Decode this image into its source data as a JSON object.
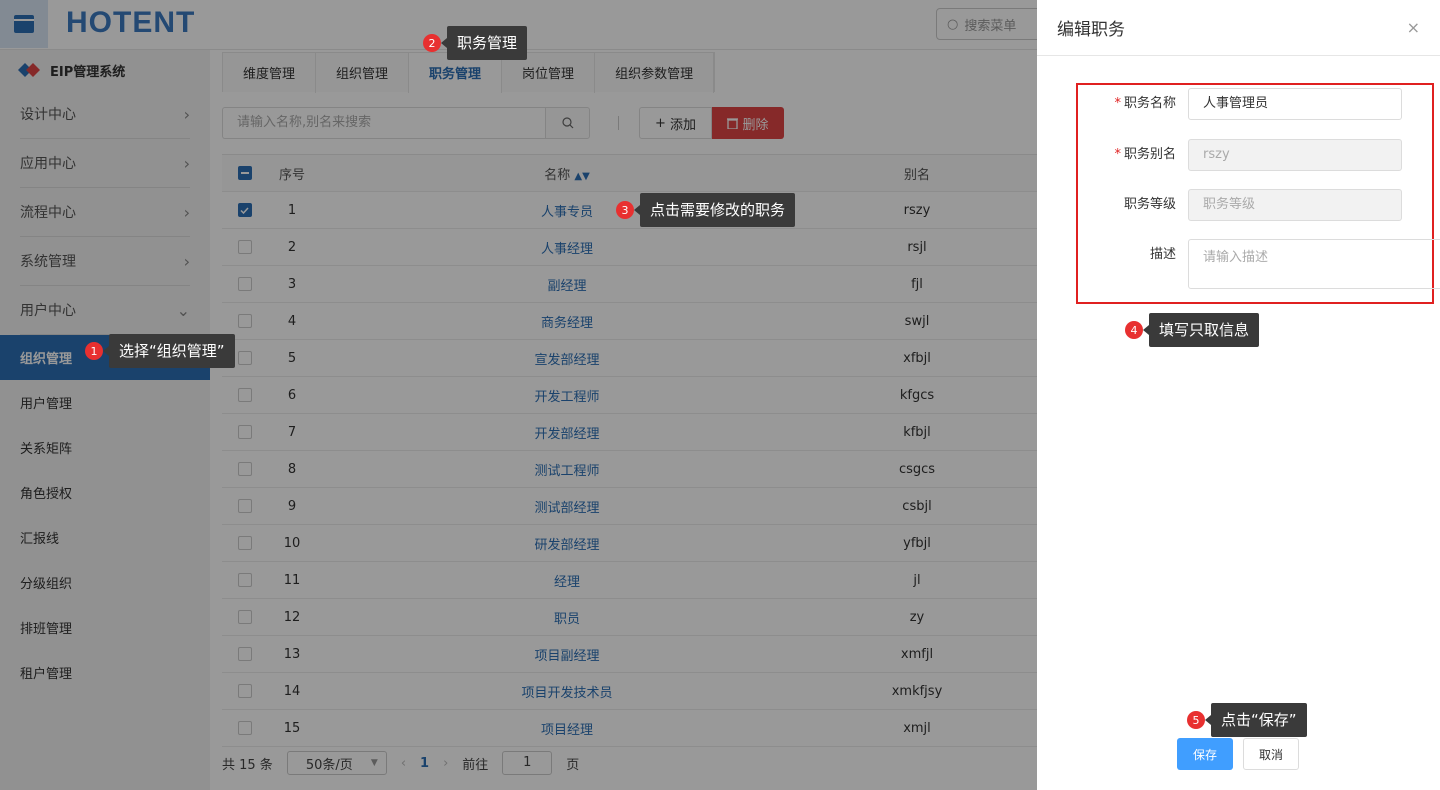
{
  "header": {
    "logo": "HOTENT",
    "search_placeholder": "搜索菜单"
  },
  "sidebar": {
    "brand": "EIP管理系统",
    "groups": [
      {
        "label": "设计中心",
        "chevron": "right"
      },
      {
        "label": "应用中心",
        "chevron": "right"
      },
      {
        "label": "流程中心",
        "chevron": "right"
      },
      {
        "label": "系统管理",
        "chevron": "right"
      },
      {
        "label": "用户中心",
        "chevron": "down"
      }
    ],
    "active_item": "组织管理",
    "items": [
      "用户管理",
      "关系矩阵",
      "角色授权",
      "汇报线",
      "分级组织",
      "排班管理",
      "租户管理"
    ]
  },
  "tabs": [
    "维度管理",
    "组织管理",
    "职务管理",
    "岗位管理",
    "组织参数管理"
  ],
  "active_tab": "职务管理",
  "toolbar": {
    "search_placeholder": "请输入名称,别名来搜索",
    "add_label": "添加",
    "delete_label": "删除"
  },
  "table": {
    "headers": {
      "index": "序号",
      "name": "名称",
      "alias": "别名"
    },
    "rows": [
      {
        "index": "1",
        "name": "人事专员",
        "alias": "rszy",
        "checked": true
      },
      {
        "index": "2",
        "name": "人事经理",
        "alias": "rsjl",
        "checked": false
      },
      {
        "index": "3",
        "name": "副经理",
        "alias": "fjl",
        "checked": false
      },
      {
        "index": "4",
        "name": "商务经理",
        "alias": "swjl",
        "checked": false
      },
      {
        "index": "5",
        "name": "宣发部经理",
        "alias": "xfbjl",
        "checked": false
      },
      {
        "index": "6",
        "name": "开发工程师",
        "alias": "kfgcs",
        "checked": false
      },
      {
        "index": "7",
        "name": "开发部经理",
        "alias": "kfbjl",
        "checked": false
      },
      {
        "index": "8",
        "name": "测试工程师",
        "alias": "csgcs",
        "checked": false
      },
      {
        "index": "9",
        "name": "测试部经理",
        "alias": "csbjl",
        "checked": false
      },
      {
        "index": "10",
        "name": "研发部经理",
        "alias": "yfbjl",
        "checked": false
      },
      {
        "index": "11",
        "name": "经理",
        "alias": "jl",
        "checked": false
      },
      {
        "index": "12",
        "name": "职员",
        "alias": "zy",
        "checked": false
      },
      {
        "index": "13",
        "name": "项目副经理",
        "alias": "xmfjl",
        "checked": false
      },
      {
        "index": "14",
        "name": "项目开发技术员",
        "alias": "xmkfjsy",
        "checked": false
      },
      {
        "index": "15",
        "name": "项目经理",
        "alias": "xmjl",
        "checked": false
      }
    ]
  },
  "pager": {
    "total": "共 15 条",
    "page_size": "50条/页",
    "current": "1",
    "goto_label": "前往",
    "goto_value": "1",
    "page_suffix": "页"
  },
  "drawer": {
    "title": "编辑职务",
    "fields": {
      "name_label": "职务名称",
      "name_value": "人事管理员",
      "alias_label": "职务别名",
      "alias_value": "rszy",
      "level_label": "职务等级",
      "level_placeholder": "职务等级",
      "desc_label": "描述",
      "desc_placeholder": "请输入描述"
    },
    "save_label": "保存",
    "cancel_label": "取消"
  },
  "callouts": [
    {
      "num": "1",
      "text": "选择“组织管理”"
    },
    {
      "num": "2",
      "text": "职务管理"
    },
    {
      "num": "3",
      "text": "点击需要修改的职务"
    },
    {
      "num": "4",
      "text": "填写只取信息"
    },
    {
      "num": "5",
      "text": "点击“保存”"
    }
  ],
  "colors": {
    "primary": "#2c6fb5",
    "danger": "#e04545",
    "save": "#409eff",
    "highlight_border": "#e02020"
  }
}
